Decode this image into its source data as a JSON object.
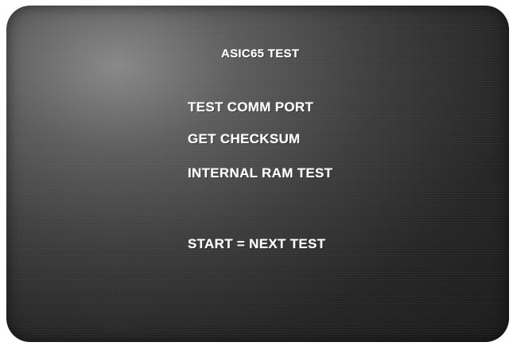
{
  "screen": {
    "title": "ASIC65 TEST",
    "menu_items": [
      {
        "label": "TEST COMM PORT"
      },
      {
        "label": "GET CHECKSUM"
      },
      {
        "label": "INTERNAL RAM TEST"
      }
    ],
    "instruction": "START = NEXT TEST"
  },
  "colors": {
    "screen_background": "#2a2a2a",
    "text": "#ffffff"
  }
}
